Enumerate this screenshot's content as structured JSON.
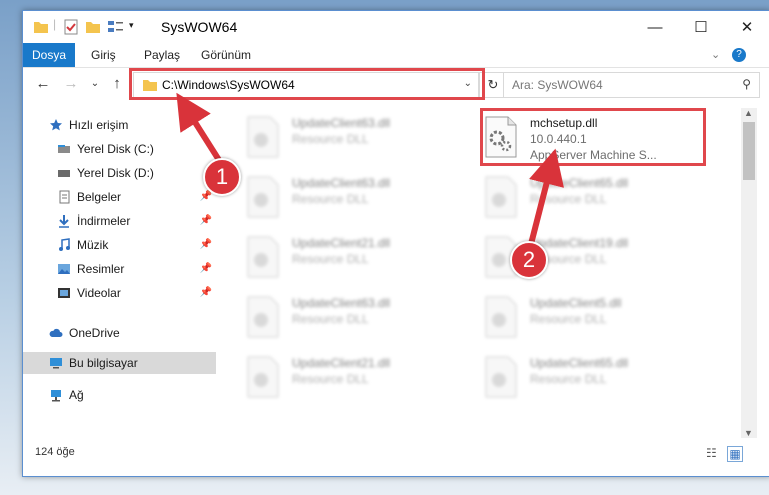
{
  "window": {
    "title": "SysWOW64"
  },
  "ribbon": {
    "tabs": [
      "Dosya",
      "Giriş",
      "Paylaş",
      "Görünüm"
    ]
  },
  "address": {
    "path": "C:\\Windows\\SysWOW64"
  },
  "search": {
    "placeholder": "Ara: SysWOW64"
  },
  "nav": {
    "items": [
      {
        "label": "Hızlı erişim",
        "icon": "star-icon",
        "pinned": false
      },
      {
        "label": "Yerel Disk (C:)",
        "icon": "drive-icon",
        "pinned": false
      },
      {
        "label": "Yerel Disk (D:)",
        "icon": "drive-icon",
        "pinned": false
      },
      {
        "label": "Belgeler",
        "icon": "documents-icon",
        "pinned": true
      },
      {
        "label": "İndirmeler",
        "icon": "download-icon",
        "pinned": true
      },
      {
        "label": "Müzik",
        "icon": "music-icon",
        "pinned": true
      },
      {
        "label": "Resimler",
        "icon": "pictures-icon",
        "pinned": true
      },
      {
        "label": "Videolar",
        "icon": "video-icon",
        "pinned": true
      },
      {
        "label": "OneDrive",
        "icon": "cloud-icon",
        "pinned": false
      },
      {
        "label": "Bu bilgisayar",
        "icon": "computer-icon",
        "pinned": false
      },
      {
        "label": "Ağ",
        "icon": "network-icon",
        "pinned": false
      }
    ]
  },
  "files": {
    "featured": {
      "name": "mchsetup.dll",
      "version": "10.0.440.1",
      "description": "AppServer Machine S..."
    },
    "left": [
      {
        "name": "UpdateClient63.dll",
        "type": "Resource DLL"
      },
      {
        "name": "UpdateClient63.dll",
        "type": "Resource DLL"
      },
      {
        "name": "UpdateClient21.dll",
        "type": "Resource DLL"
      },
      {
        "name": "UpdateClient63.dll",
        "type": "Resource DLL"
      },
      {
        "name": "UpdateClient21.dll",
        "type": "Resource DLL"
      }
    ],
    "right": [
      {
        "name": "UpdateClient65.dll",
        "type": "Resource DLL"
      },
      {
        "name": "UpdateClient19.dll",
        "type": "Resource DLL"
      },
      {
        "name": "UpdateClient5.dll",
        "type": "Resource DLL"
      },
      {
        "name": "UpdateClient65.dll",
        "type": "Resource DLL"
      }
    ]
  },
  "status": {
    "count": "124 öğe"
  },
  "annotations": {
    "step1": "1",
    "step2": "2"
  },
  "colors": {
    "accent": "#1979ca",
    "highlight": "#e0474c",
    "badge": "#d9333a"
  }
}
